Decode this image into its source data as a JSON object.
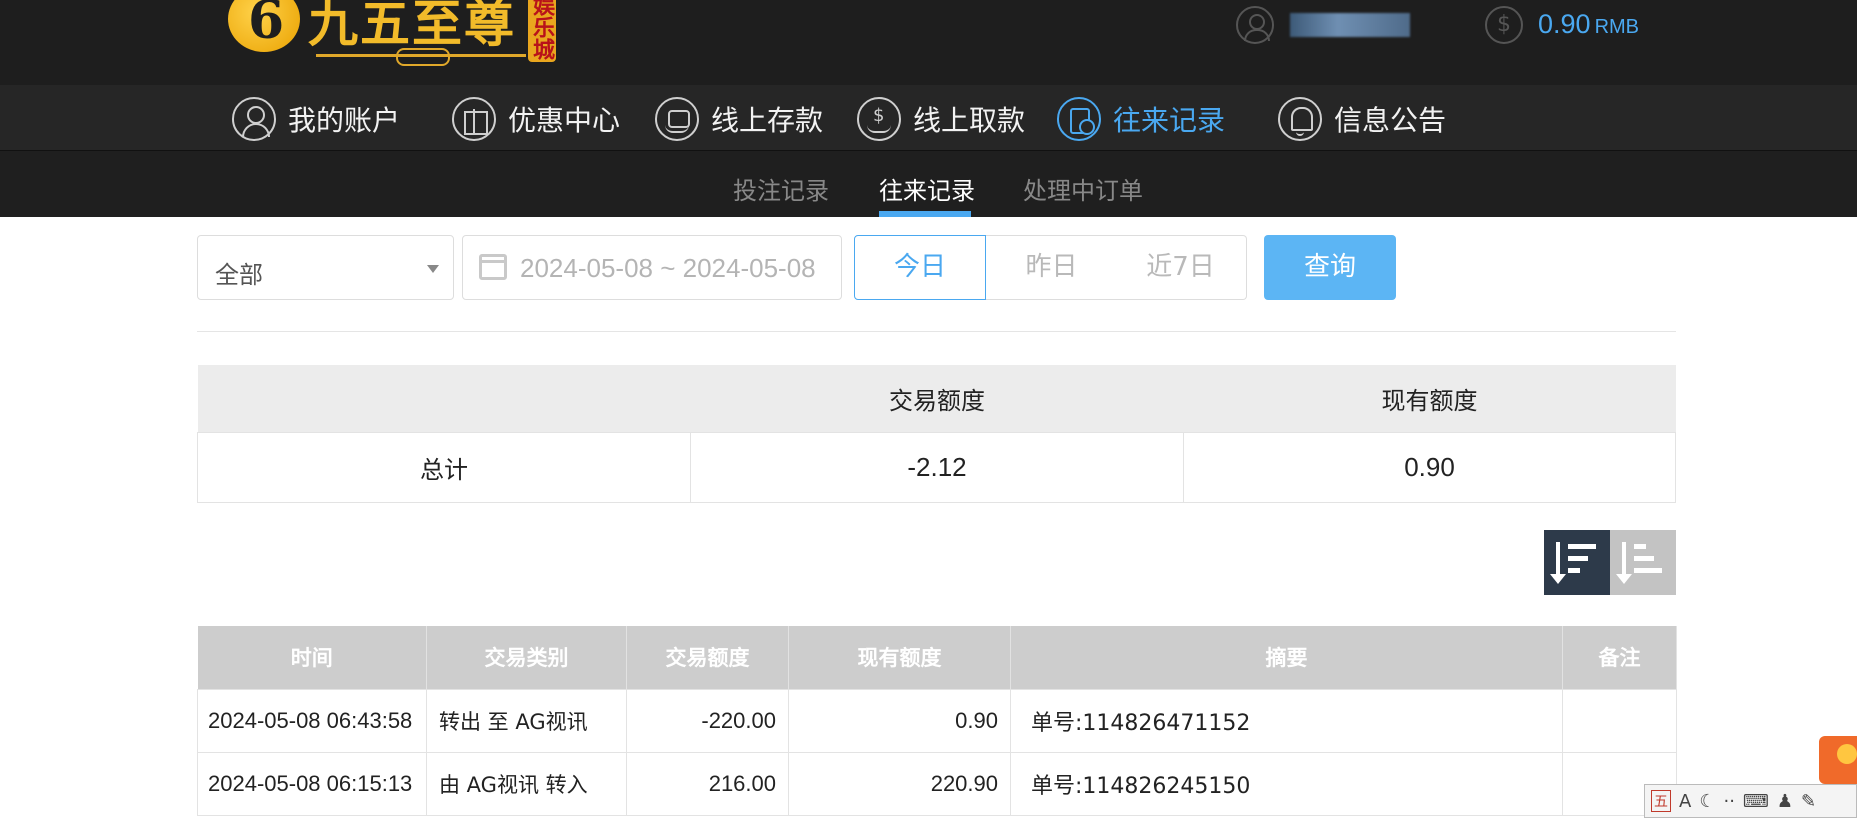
{
  "header": {
    "logo_text": "九五至尊",
    "logo_badge": "娱乐城",
    "balance_value": "0.90",
    "balance_unit": "RMB"
  },
  "main_nav": [
    {
      "label": "我的账户",
      "icon": "user-icon",
      "active": false
    },
    {
      "label": "优惠中心",
      "icon": "gift-icon",
      "active": false
    },
    {
      "label": "线上存款",
      "icon": "deposit-icon",
      "active": false
    },
    {
      "label": "线上取款",
      "icon": "withdraw-icon",
      "active": false
    },
    {
      "label": "往来记录",
      "icon": "records-icon",
      "active": true
    },
    {
      "label": "信息公告",
      "icon": "bell-icon",
      "active": false
    }
  ],
  "sub_nav": [
    {
      "label": "投注记录",
      "active": false
    },
    {
      "label": "往来记录",
      "active": true
    },
    {
      "label": "处理中订单",
      "active": false
    }
  ],
  "filters": {
    "type_select": "全部",
    "date_range": "2024-05-08 ~ 2024-05-08",
    "quick_today": "今日",
    "quick_yesterday": "昨日",
    "quick_7days": "近7日",
    "search_button": "查询"
  },
  "summary": {
    "headers": [
      "",
      "交易额度",
      "现有额度"
    ],
    "row_label": "总计",
    "trade_total": "-2.12",
    "current_total": "0.90"
  },
  "records": {
    "headers": [
      "时间",
      "交易类别",
      "交易额度",
      "现有额度",
      "摘要",
      "备注"
    ],
    "rows": [
      {
        "time": "2024-05-08 06:43:58",
        "type": "转出 至 AG视讯",
        "amount": "-220.00",
        "balance": "0.90",
        "summary": "单号:114826471152",
        "note": ""
      },
      {
        "time": "2024-05-08 06:15:13",
        "type": "由 AG视讯 转入",
        "amount": "216.00",
        "balance": "220.90",
        "summary": "单号:114826245150",
        "note": ""
      }
    ]
  },
  "ime_bar": {
    "mode": "五",
    "font": "A"
  },
  "colors": {
    "accent": "#4aa8f0",
    "header_bg": "#1e1e1e",
    "nav_bg": "#262626",
    "table_header_bg": "#cdcdcd"
  }
}
